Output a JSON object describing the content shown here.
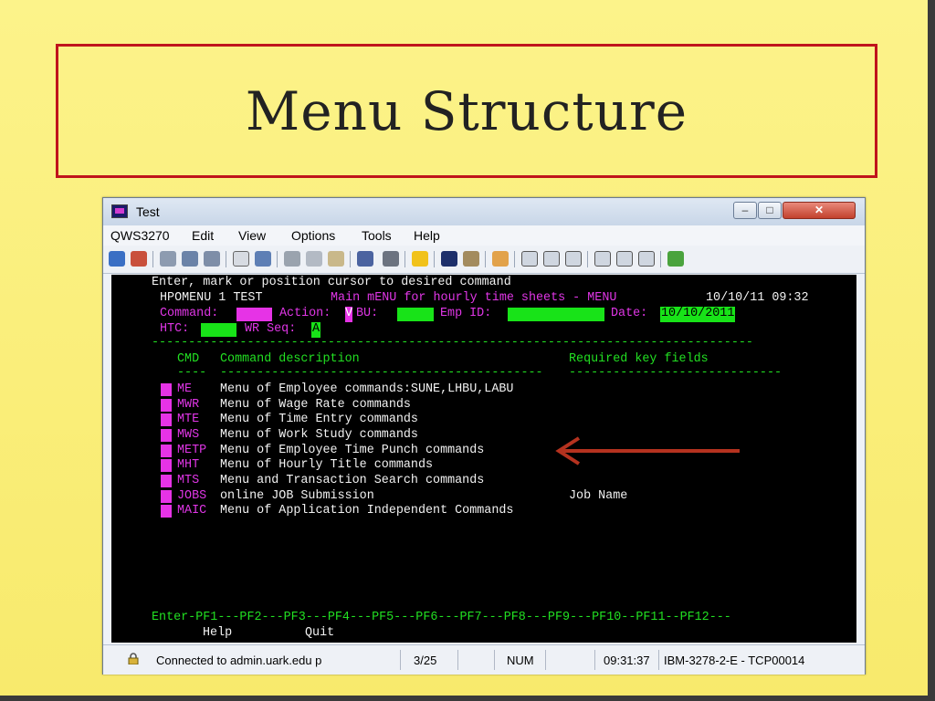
{
  "slide": {
    "title": "Menu Structure"
  },
  "window": {
    "title": "Test",
    "controls": {
      "minimize": "–",
      "maximize": "□",
      "close": "✕"
    },
    "menu": [
      "QWS3270",
      "Edit",
      "View",
      "Options",
      "Tools",
      "Help"
    ]
  },
  "terminal": {
    "instruction": "Enter, mark or position cursor to desired command",
    "screen_id": "HPOMENU 1 TEST",
    "screen_title": "Main mENU for hourly time sheets - MENU",
    "datetime": "10/10/11 09:32",
    "command_label": "Command:",
    "action_label": "Action:",
    "action_value": "V",
    "bu_label": "BU:",
    "emp_id_label": "Emp ID:",
    "date_label": "Date:",
    "date_value": "10/10/2011",
    "htc_label": "HTC:",
    "wr_seq_label": "WR Seq:",
    "wr_seq_value": "A",
    "separator": "----------------------------------------------------------------------------------",
    "headers": {
      "cmd": "CMD",
      "description": "Command description",
      "required": "Required key fields"
    },
    "header_underline": {
      "cmd": "----",
      "description": "--------------------------------------------",
      "required": "-----------------------------"
    },
    "rows": [
      {
        "cmd": "ME",
        "desc": "Menu of Employee commands:SUNE,LHBU,LABU",
        "req": ""
      },
      {
        "cmd": "MWR",
        "desc": "Menu of Wage Rate commands",
        "req": ""
      },
      {
        "cmd": "MTE",
        "desc": "Menu of Time Entry commands",
        "req": ""
      },
      {
        "cmd": "MWS",
        "desc": "Menu of Work Study commands",
        "req": ""
      },
      {
        "cmd": "METP",
        "desc": "Menu of Employee Time Punch commands",
        "req": ""
      },
      {
        "cmd": "MHT",
        "desc": "Menu of Hourly Title commands",
        "req": ""
      },
      {
        "cmd": "MTS",
        "desc": "Menu and Transaction Search commands",
        "req": ""
      },
      {
        "cmd": "JOBS",
        "desc": "online JOB Submission",
        "req": "Job Name"
      },
      {
        "cmd": "MAIC",
        "desc": "Menu of Application Independent Commands",
        "req": ""
      }
    ],
    "pf_line": "Enter-PF1---PF2---PF3---PF4---PF5---PF6---PF7---PF8---PF9---PF10--PF11--PF12---",
    "pf_help": "Help",
    "pf_quit": "Quit"
  },
  "statusbar": {
    "connection": "Connected to admin.uark.edu p",
    "position": "3/25",
    "num": "NUM",
    "time": "09:31:37",
    "session": "IBM-3278-2-E - TCP00014"
  },
  "colors": {
    "slide_bg": "#fbf07a",
    "title_border": "#c0141c",
    "arrow": "#b5321f",
    "terminal_bg": "#000000",
    "green": "#22e022",
    "magenta": "#e036e6"
  }
}
